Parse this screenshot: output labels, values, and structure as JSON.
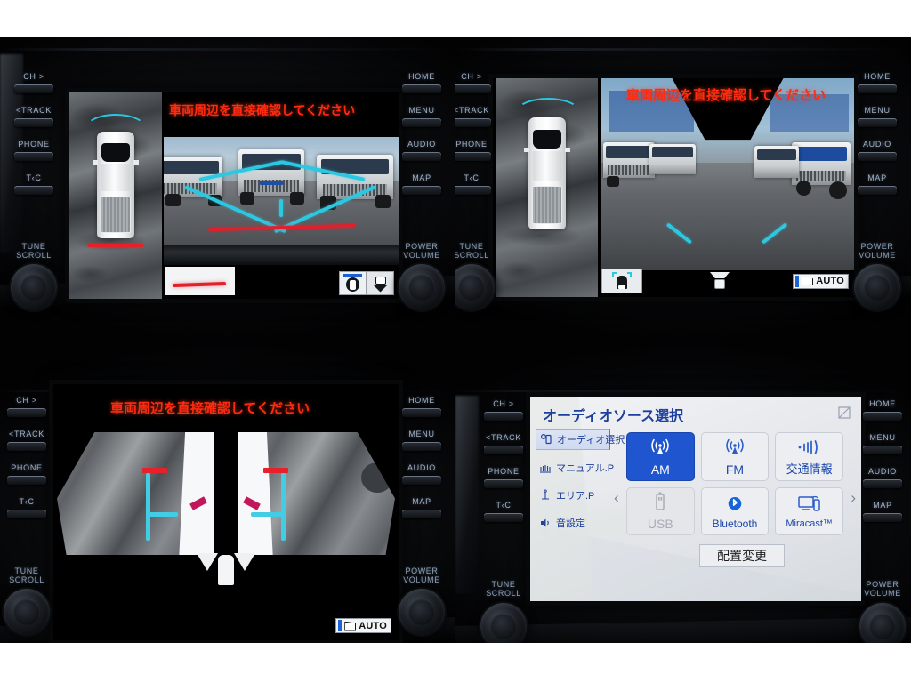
{
  "hardkeys": {
    "left": [
      {
        "label": "CH >",
        "name": "ch-up-button"
      },
      {
        "label": "<TRACK",
        "name": "track-back-button"
      },
      {
        "label": "PHONE",
        "name": "phone-button"
      },
      {
        "label": "T‹C",
        "name": "talk-cancel-button"
      }
    ],
    "left_knob": "TUNE\nSCROLL",
    "left_knob_line1": "TUNE",
    "left_knob_line2": "SCROLL",
    "right": [
      {
        "label": "HOME",
        "name": "home-button"
      },
      {
        "label": "MENU",
        "name": "menu-button"
      },
      {
        "label": "AUDIO",
        "name": "audio-button"
      },
      {
        "label": "MAP",
        "name": "map-button"
      }
    ],
    "right_knob_line1": "POWER",
    "right_knob_line2": "VOLUME"
  },
  "camera": {
    "warning": "車両周辺を直接確認してください",
    "auto_label": "AUTO"
  },
  "panels": {
    "top_left": {
      "name": "panoramic-view-rear",
      "warning": "車両周辺を直接確認してください",
      "mode_icons": [
        "panoramic-view-icon",
        "rear-view-icon"
      ],
      "selected_mode": "panoramic-view-icon"
    },
    "top_right": {
      "name": "wide-rear-view",
      "warning": "車両周辺を直接確認してください",
      "auto_label": "AUTO",
      "mode_icons": [
        "wide-rear-view-icon",
        "narrow-rear-view-icon"
      ],
      "selected_mode": "wide-rear-view-icon"
    },
    "bottom_left": {
      "name": "side-view-camera",
      "warning": "車両周辺を直接確認してください",
      "auto_label": "AUTO"
    }
  },
  "audio_screen": {
    "title": "オーディオソース選択",
    "minimize_icon": "minimize-icon",
    "sidebar": [
      {
        "label": "オーディオ選択",
        "icon": "audio-select-icon",
        "selected": true
      },
      {
        "label": "マニュアル.P",
        "icon": "manual-preset-icon",
        "selected": false
      },
      {
        "label": "エリア.P",
        "icon": "area-preset-icon",
        "selected": false
      },
      {
        "label": "音設定",
        "icon": "sound-settings-icon",
        "selected": false
      }
    ],
    "page_prev": "‹",
    "page_next": "›",
    "tiles": [
      {
        "label": "AM",
        "icon": "radio-tower-icon",
        "state": "selected"
      },
      {
        "label": "FM",
        "icon": "radio-tower-icon",
        "state": "normal"
      },
      {
        "label": "交通情報",
        "icon": "traffic-signal-icon",
        "state": "normal"
      },
      {
        "label": "USB",
        "icon": "usb-icon",
        "state": "disabled"
      },
      {
        "label": "Bluetooth",
        "icon": "bluetooth-icon",
        "state": "normal"
      },
      {
        "label": "Miracast™",
        "icon": "miracast-icon",
        "state": "normal"
      }
    ],
    "rearrange_button": "配置変更",
    "colors": {
      "accent_blue": "#1f55cf",
      "title_blue": "#1d3f9e",
      "disabled_grey": "#a8adb5",
      "panel_bg": "#eceef1"
    }
  }
}
